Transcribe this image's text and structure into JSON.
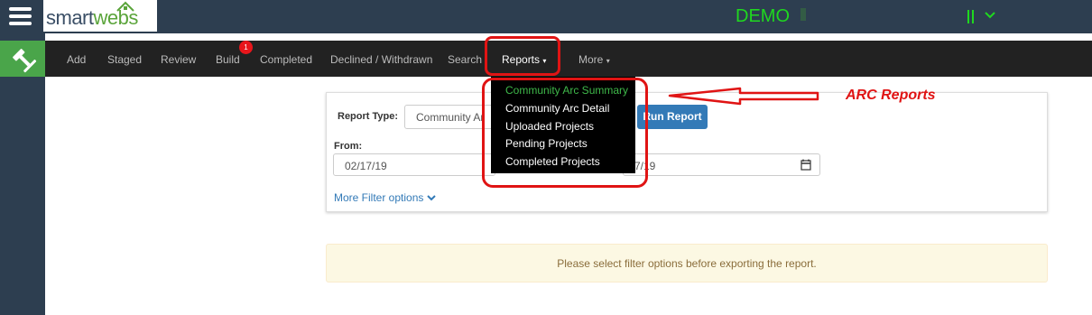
{
  "brand": {
    "smart": "smart",
    "webs": "webs"
  },
  "account": {
    "label": "DEMO",
    "chevron": "⌄"
  },
  "nav": {
    "add": "Add",
    "staged": "Staged",
    "review": "Review",
    "build": "Build",
    "build_badge": "1",
    "completed": "Completed",
    "declined": "Declined / Withdrawn",
    "search": "Search",
    "reports": "Reports",
    "more": "More"
  },
  "reports_menu": {
    "items": [
      "Community Arc Summary",
      "Community Arc Detail",
      "Uploaded Projects",
      "Pending Projects",
      "Completed Projects"
    ]
  },
  "form": {
    "report_type_label": "Report Type:",
    "report_type_value": "Community Ar",
    "run_report": "Run Report",
    "from_label": "From:",
    "from_value": "02/17/19",
    "to_value_partial": "7/19",
    "more_filter": "More Filter options"
  },
  "alert": {
    "text": "Please select filter options before exporting the report."
  },
  "annotation": {
    "label": "ARC Reports"
  },
  "colors": {
    "topbar": "#2d3e50",
    "navbar": "#222222",
    "accent_green": "#4aa54a",
    "demo_green": "#1fd81f",
    "annotation_red": "#e01414",
    "primary_blue": "#337ab7"
  }
}
